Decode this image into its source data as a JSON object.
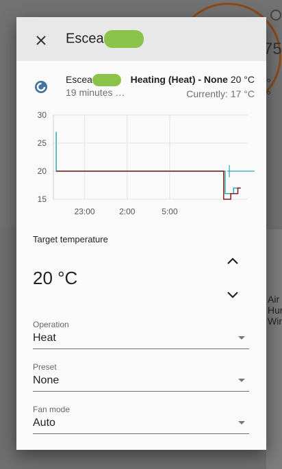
{
  "background": {
    "right_value": "75",
    "right_labels": [
      "Air",
      "Hun",
      "Win"
    ],
    "right_marks": [
      "°",
      "°"
    ]
  },
  "dialog": {
    "title": "Escea",
    "entity": {
      "name": "Escea",
      "last_changed": "19 minutes …",
      "state_main": "Heating (Heat) - None",
      "state_temp": "20 °C",
      "current": "Currently: 17 °C"
    },
    "chart_data": {
      "type": "line",
      "ylim": [
        15,
        30
      ],
      "y_ticks": [
        15,
        20,
        25,
        30
      ],
      "x_ticks": [
        "23:00",
        "2:00",
        "5:00"
      ],
      "colors": {
        "current": "#2aa9b1",
        "target": "#8b1a1a"
      },
      "series": [
        {
          "values": [
            [
              0,
              20
            ],
            [
              0,
              27
            ],
            [
              0,
              25.5
            ],
            [
              0,
              26
            ],
            [
              0,
              20
            ],
            [
              11.9,
              20
            ],
            [
              11.9,
              16
            ],
            [
              12.5,
              16
            ],
            [
              12.5,
              17
            ],
            [
              13.0,
              17
            ]
          ]
        },
        {
          "values": [
            [
              0,
              20
            ],
            [
              11.8,
              20
            ],
            [
              11.8,
              15
            ],
            [
              12.3,
              15
            ],
            [
              12.3,
              16
            ],
            [
              12.8,
              16
            ],
            [
              12.8,
              17
            ],
            [
              13.0,
              17
            ]
          ]
        }
      ]
    },
    "target_label": "Target temperature",
    "target_value": "20 °C",
    "operation": {
      "label": "Operation",
      "value": "Heat"
    },
    "preset": {
      "label": "Preset",
      "value": "None"
    },
    "fan_mode": {
      "label": "Fan mode",
      "value": "Auto"
    }
  }
}
